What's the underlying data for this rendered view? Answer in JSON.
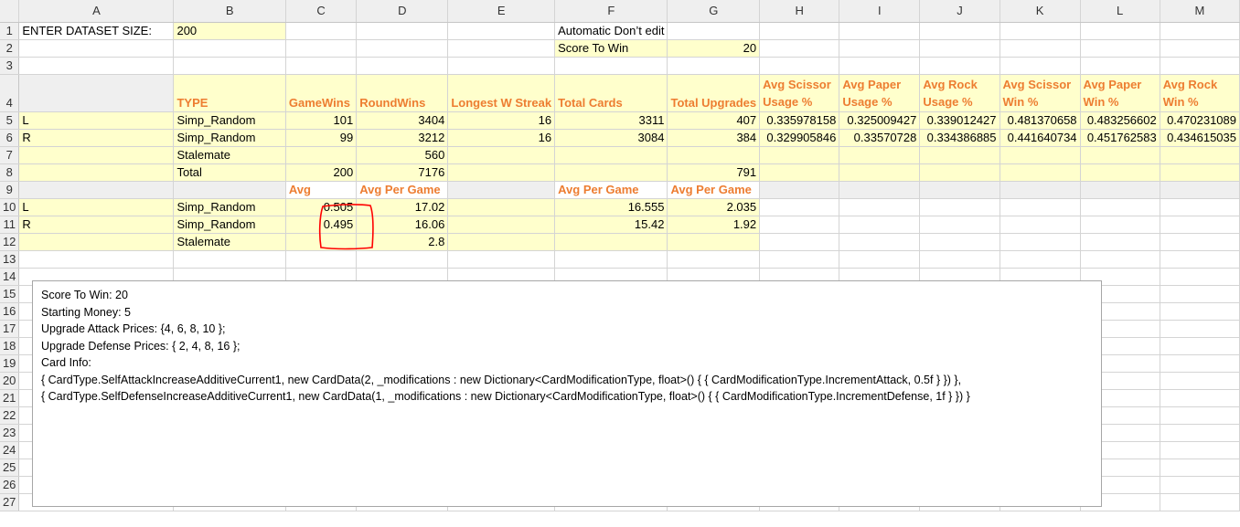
{
  "columns": [
    "A",
    "B",
    "C",
    "D",
    "E",
    "F",
    "G",
    "H",
    "I",
    "J",
    "K",
    "L",
    "M"
  ],
  "rows": [
    {
      "n": "1",
      "cells": [
        "ENTER DATASET SIZE:",
        "200",
        "",
        "",
        "",
        "Automatic Don’t edit",
        "",
        "",
        "",
        "",
        "",
        "",
        ""
      ]
    },
    {
      "n": "2",
      "cells": [
        "",
        "",
        "",
        "",
        "",
        "Score To Win",
        "20",
        "",
        "",
        "",
        "",
        "",
        ""
      ]
    },
    {
      "n": "3",
      "cells": [
        "",
        "",
        "",
        "",
        "",
        "",
        "",
        "",
        "",
        "",
        "",
        "",
        ""
      ]
    },
    {
      "n": "4",
      "cells": [
        "",
        "TYPE",
        "GameWins",
        "RoundWins",
        "Longest W Streak",
        "Total Cards",
        "Total Upgrades",
        "Avg Scissor Usage %",
        "Avg Paper Usage %",
        "Avg Rock Usage %",
        "Avg Scissor Win %",
        "Avg Paper Win %",
        "Avg Rock Win %"
      ]
    },
    {
      "n": "5",
      "cells": [
        "L",
        "Simp_Random",
        "101",
        "3404",
        "16",
        "3311",
        "407",
        "0.335978158",
        "0.325009427",
        "0.339012427",
        "0.481370658",
        "0.483256602",
        "0.470231089"
      ]
    },
    {
      "n": "6",
      "cells": [
        "R",
        "Simp_Random",
        "99",
        "3212",
        "16",
        "3084",
        "384",
        "0.329905846",
        "0.33570728",
        "0.334386885",
        "0.441640734",
        "0.451762583",
        "0.434615035"
      ]
    },
    {
      "n": "7",
      "cells": [
        "",
        "Stalemate",
        "",
        "560",
        "",
        "",
        "",
        "",
        "",
        "",
        "",
        "",
        ""
      ]
    },
    {
      "n": "8",
      "cells": [
        "",
        "Total",
        "200",
        "7176",
        "",
        "",
        "791",
        "",
        "",
        "",
        "",
        "",
        ""
      ]
    },
    {
      "n": "9",
      "cells": [
        "",
        "",
        "Avg",
        "Avg Per Game",
        "",
        "Avg Per Game",
        "Avg Per Game",
        "",
        "",
        "",
        "",
        "",
        ""
      ]
    },
    {
      "n": "10",
      "cells": [
        "L",
        "Simp_Random",
        "0.505",
        "17.02",
        "",
        "16.555",
        "2.035",
        "",
        "",
        "",
        "",
        "",
        ""
      ]
    },
    {
      "n": "11",
      "cells": [
        "R",
        "Simp_Random",
        "0.495",
        "16.06",
        "",
        "15.42",
        "1.92",
        "",
        "",
        "",
        "",
        "",
        ""
      ]
    },
    {
      "n": "12",
      "cells": [
        "",
        "Stalemate",
        "",
        "2.8",
        "",
        "",
        "",
        "",
        "",
        "",
        "",
        "",
        ""
      ]
    },
    {
      "n": "13",
      "cells": [
        "",
        "",
        "",
        "",
        "",
        "",
        "",
        "",
        "",
        "",
        "",
        "",
        ""
      ]
    },
    {
      "n": "14",
      "cells": [
        "",
        "",
        "",
        "",
        "",
        "",
        "",
        "",
        "",
        "",
        "",
        "",
        ""
      ]
    },
    {
      "n": "15",
      "cells": [
        "",
        "",
        "",
        "",
        "",
        "",
        "",
        "",
        "",
        "",
        "",
        "",
        ""
      ]
    },
    {
      "n": "16",
      "cells": [
        "",
        "",
        "",
        "",
        "",
        "",
        "",
        "",
        "",
        "",
        "",
        "",
        ""
      ]
    },
    {
      "n": "17",
      "cells": [
        "",
        "",
        "",
        "",
        "",
        "",
        "",
        "",
        "",
        "",
        "",
        "",
        ""
      ]
    },
    {
      "n": "18",
      "cells": [
        "",
        "",
        "",
        "",
        "",
        "",
        "",
        "",
        "",
        "",
        "",
        "",
        ""
      ]
    },
    {
      "n": "19",
      "cells": [
        "",
        "",
        "",
        "",
        "",
        "",
        "",
        "",
        "",
        "",
        "",
        "",
        ""
      ]
    },
    {
      "n": "20",
      "cells": [
        "",
        "",
        "",
        "",
        "",
        "",
        "",
        "",
        "",
        "",
        "",
        "",
        ""
      ]
    },
    {
      "n": "21",
      "cells": [
        "",
        "",
        "",
        "",
        "",
        "",
        "",
        "",
        "",
        "",
        "",
        "",
        ""
      ]
    },
    {
      "n": "22",
      "cells": [
        "",
        "",
        "",
        "",
        "",
        "",
        "",
        "",
        "",
        "",
        "",
        "",
        ""
      ]
    },
    {
      "n": "23",
      "cells": [
        "",
        "",
        "",
        "",
        "",
        "",
        "",
        "",
        "",
        "",
        "",
        "",
        ""
      ]
    },
    {
      "n": "24",
      "cells": [
        "",
        "",
        "",
        "",
        "",
        "",
        "",
        "",
        "",
        "",
        "",
        "",
        ""
      ]
    },
    {
      "n": "25",
      "cells": [
        "",
        "",
        "",
        "",
        "",
        "",
        "",
        "",
        "",
        "",
        "",
        "",
        ""
      ]
    },
    {
      "n": "26",
      "cells": [
        "",
        "",
        "",
        "",
        "",
        "",
        "",
        "",
        "",
        "",
        "",
        "",
        ""
      ]
    },
    {
      "n": "27",
      "cells": [
        "",
        "",
        "",
        "",
        "",
        "",
        "",
        "",
        "",
        "",
        "",
        "",
        ""
      ]
    }
  ],
  "note": {
    "lines": [
      "Score To Win: 20",
      "Starting Money: 5",
      "Upgrade Attack Prices: {4, 6, 8, 10 };",
      "Upgrade Defense Prices:  { 2, 4, 8, 16 };",
      "Card Info:",
      "{ CardType.SelfAttackIncreaseAdditiveCurrent1, new CardData(2, _modifications : new Dictionary<CardModificationType, float>() { { CardModificationType.IncrementAttack, 0.5f } }) },",
      "{ CardType.SelfDefenseIncreaseAdditiveCurrent1, new CardData(1, _modifications : new Dictionary<CardModificationType, float>() { { CardModificationType.IncrementDefense, 1f } }) }"
    ]
  },
  "colors": {
    "input_fill": "#ffffcc",
    "header_text": "#ed7d31",
    "annotation": "#ff0000",
    "grid": "#d4d4d4"
  }
}
